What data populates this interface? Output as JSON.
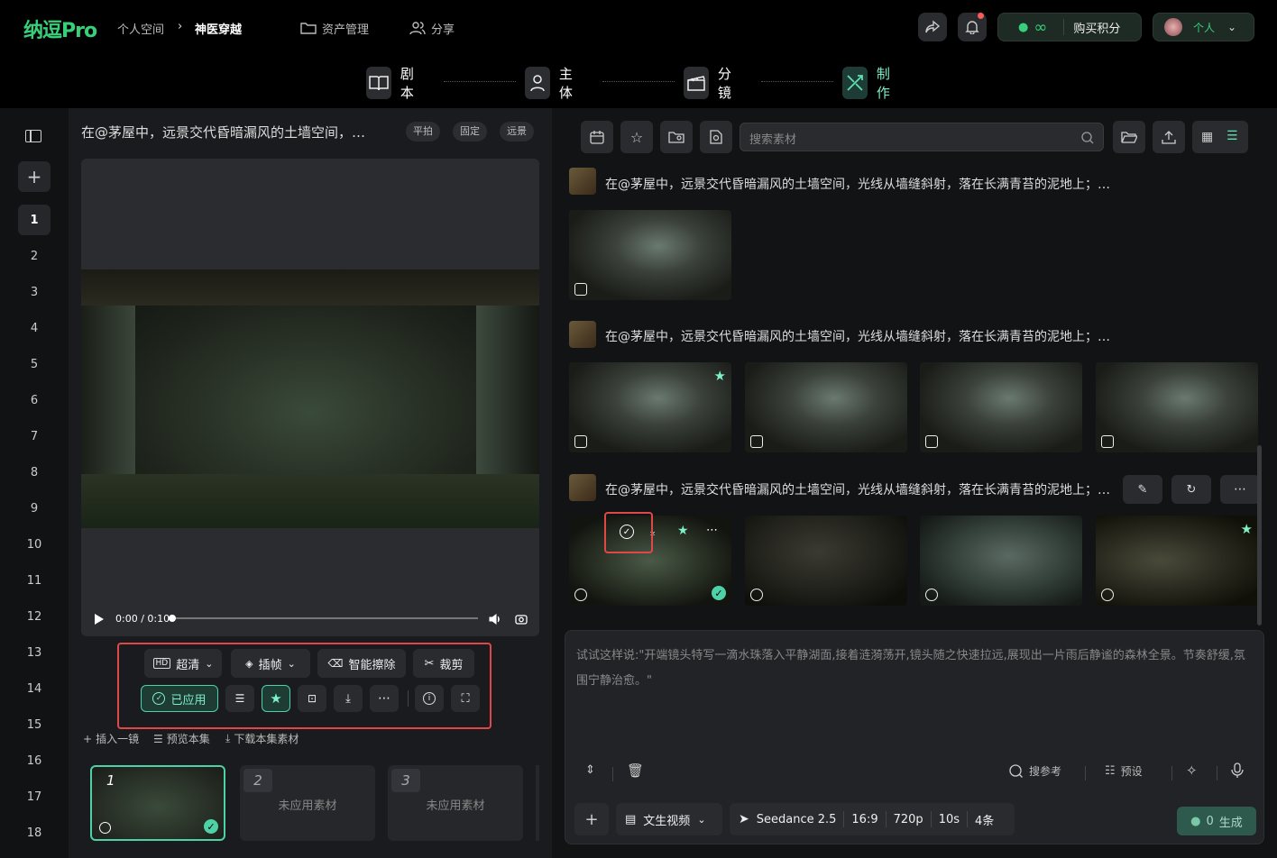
{
  "brand": "纳逗Pro",
  "breadcrumb": {
    "space": "个人空间",
    "project": "神医穿越"
  },
  "topnav": {
    "assets": "资产管理",
    "share": "分享"
  },
  "credits": {
    "value": "∞",
    "buy": "购买积分"
  },
  "account": {
    "label": "个人"
  },
  "steps": [
    {
      "label": "剧本"
    },
    {
      "label": "主体"
    },
    {
      "label": "分镜"
    },
    {
      "label": "制作"
    }
  ],
  "sidebar": {
    "numbers": [
      "1",
      "2",
      "3",
      "4",
      "5",
      "6",
      "7",
      "8",
      "9",
      "10",
      "11",
      "12",
      "13",
      "14",
      "15",
      "16",
      "17",
      "18"
    ]
  },
  "shot": {
    "title": "在@茅屋中，远景交代昏暗漏风的土墙空间，…",
    "tags": [
      "平拍",
      "固定",
      "远景"
    ]
  },
  "player": {
    "time": "0:00 / 0:10"
  },
  "toolbar": {
    "hd": "超清",
    "interp": "插帧",
    "erase": "智能擦除",
    "crop": "裁剪",
    "applied": "已应用"
  },
  "actions": {
    "insert": "插入一镜",
    "preview": "预览本集",
    "download": "下载本集素材"
  },
  "cards": [
    {
      "num": "1",
      "text": ""
    },
    {
      "num": "2",
      "text": "未应用素材"
    },
    {
      "num": "3",
      "text": "未应用素材"
    }
  ],
  "search": {
    "placeholder": "搜索素材"
  },
  "prompts": [
    {
      "text": "在@茅屋中，远景交代昏暗漏风的土墙空间，光线从墙缝斜射，落在长满青苔的泥地上；…"
    },
    {
      "text": "在@茅屋中，远景交代昏暗漏风的土墙空间，光线从墙缝斜射，落在长满青苔的泥地上；…"
    },
    {
      "text": "在@茅屋中，远景交代昏暗漏风的土墙空间，光线从墙缝斜射，落在长满青苔的泥地上；…"
    }
  ],
  "composer": {
    "placeholder": "试试这样说:\"开端镜头特写一滴水珠落入平静湖面,接着涟漪荡开,镜头随之快速拉远,展现出一片雨后静谧的森林全景。节奏舒缓,氛围宁静治愈。\"",
    "search_ref": "搜参考",
    "preset": "预设",
    "mode": "文生视频",
    "model": "Seedance 2.5",
    "ratio": "16:9",
    "res": "720p",
    "dur": "10s",
    "count": "4条",
    "gen_count": "0",
    "gen_label": "生成"
  }
}
